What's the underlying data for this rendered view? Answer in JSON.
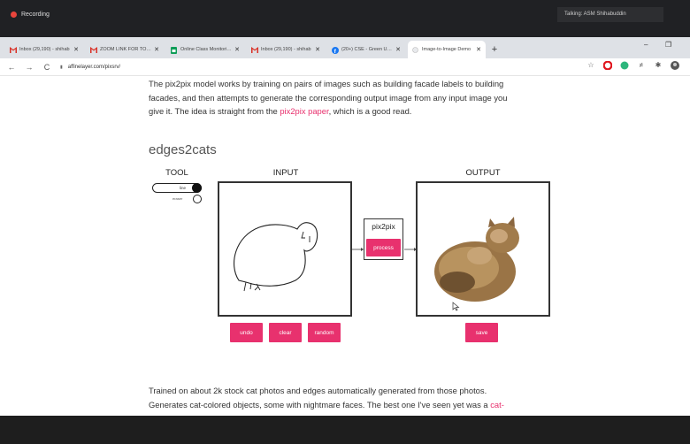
{
  "recording": {
    "label": "Recording",
    "talking": "Talking: ASM Shihabuddin"
  },
  "tabs": [
    {
      "label": "Inbox (29,190) - shihab",
      "icon": "gmail-icon",
      "active": false
    },
    {
      "label": "ZOOM LINK FOR TODAY",
      "icon": "gmail-icon",
      "active": false
    },
    {
      "label": "Online Class Monitoring",
      "icon": "sheets-icon",
      "active": false
    },
    {
      "label": "Inbox (29,190) - shihab",
      "icon": "gmail-icon",
      "active": false
    },
    {
      "label": "(20+) CSE - Green Univ.",
      "icon": "facebook-icon",
      "active": false
    },
    {
      "label": "Image-to-Image Demo",
      "icon": "page-icon",
      "active": true
    }
  ],
  "newtab": "+",
  "window": {
    "minimize": "–",
    "restore": "❐"
  },
  "addressbar": {
    "back": "←",
    "forward": "→",
    "reload": "C",
    "lock": "🔒",
    "url": "affinelayer.com/pixsrv/"
  },
  "page": {
    "intro_line1": "The pix2pix model works by training on pairs of images such as building facade labels to building",
    "intro_line2": "facades, and then attempts to generate the corresponding output image from any input image you",
    "intro_line3_pre": "give it. The idea is straight from the ",
    "intro_link": "pix2pix paper",
    "intro_line3_post": ", which is a good read.",
    "section_title": "edges2cats",
    "tool_label": "TOOL",
    "input_label": "INPUT",
    "output_label": "OUTPUT",
    "tool_line": "line",
    "tool_eraser": "eraser",
    "pix2pix_label": "pix2pix",
    "process_button": "process",
    "undo_button": "undo",
    "clear_button": "clear",
    "random_button": "random",
    "save_button": "save",
    "bottom_line1": "Trained on about 2k stock cat photos and edges automatically generated from those photos.",
    "bottom_line2_pre": "Generates cat-colored objects, some with nightmare faces. The best one I've seen yet was a ",
    "bottom_link": "cat-"
  },
  "colors": {
    "accent": "#e8316e",
    "link": "#e8316e"
  }
}
